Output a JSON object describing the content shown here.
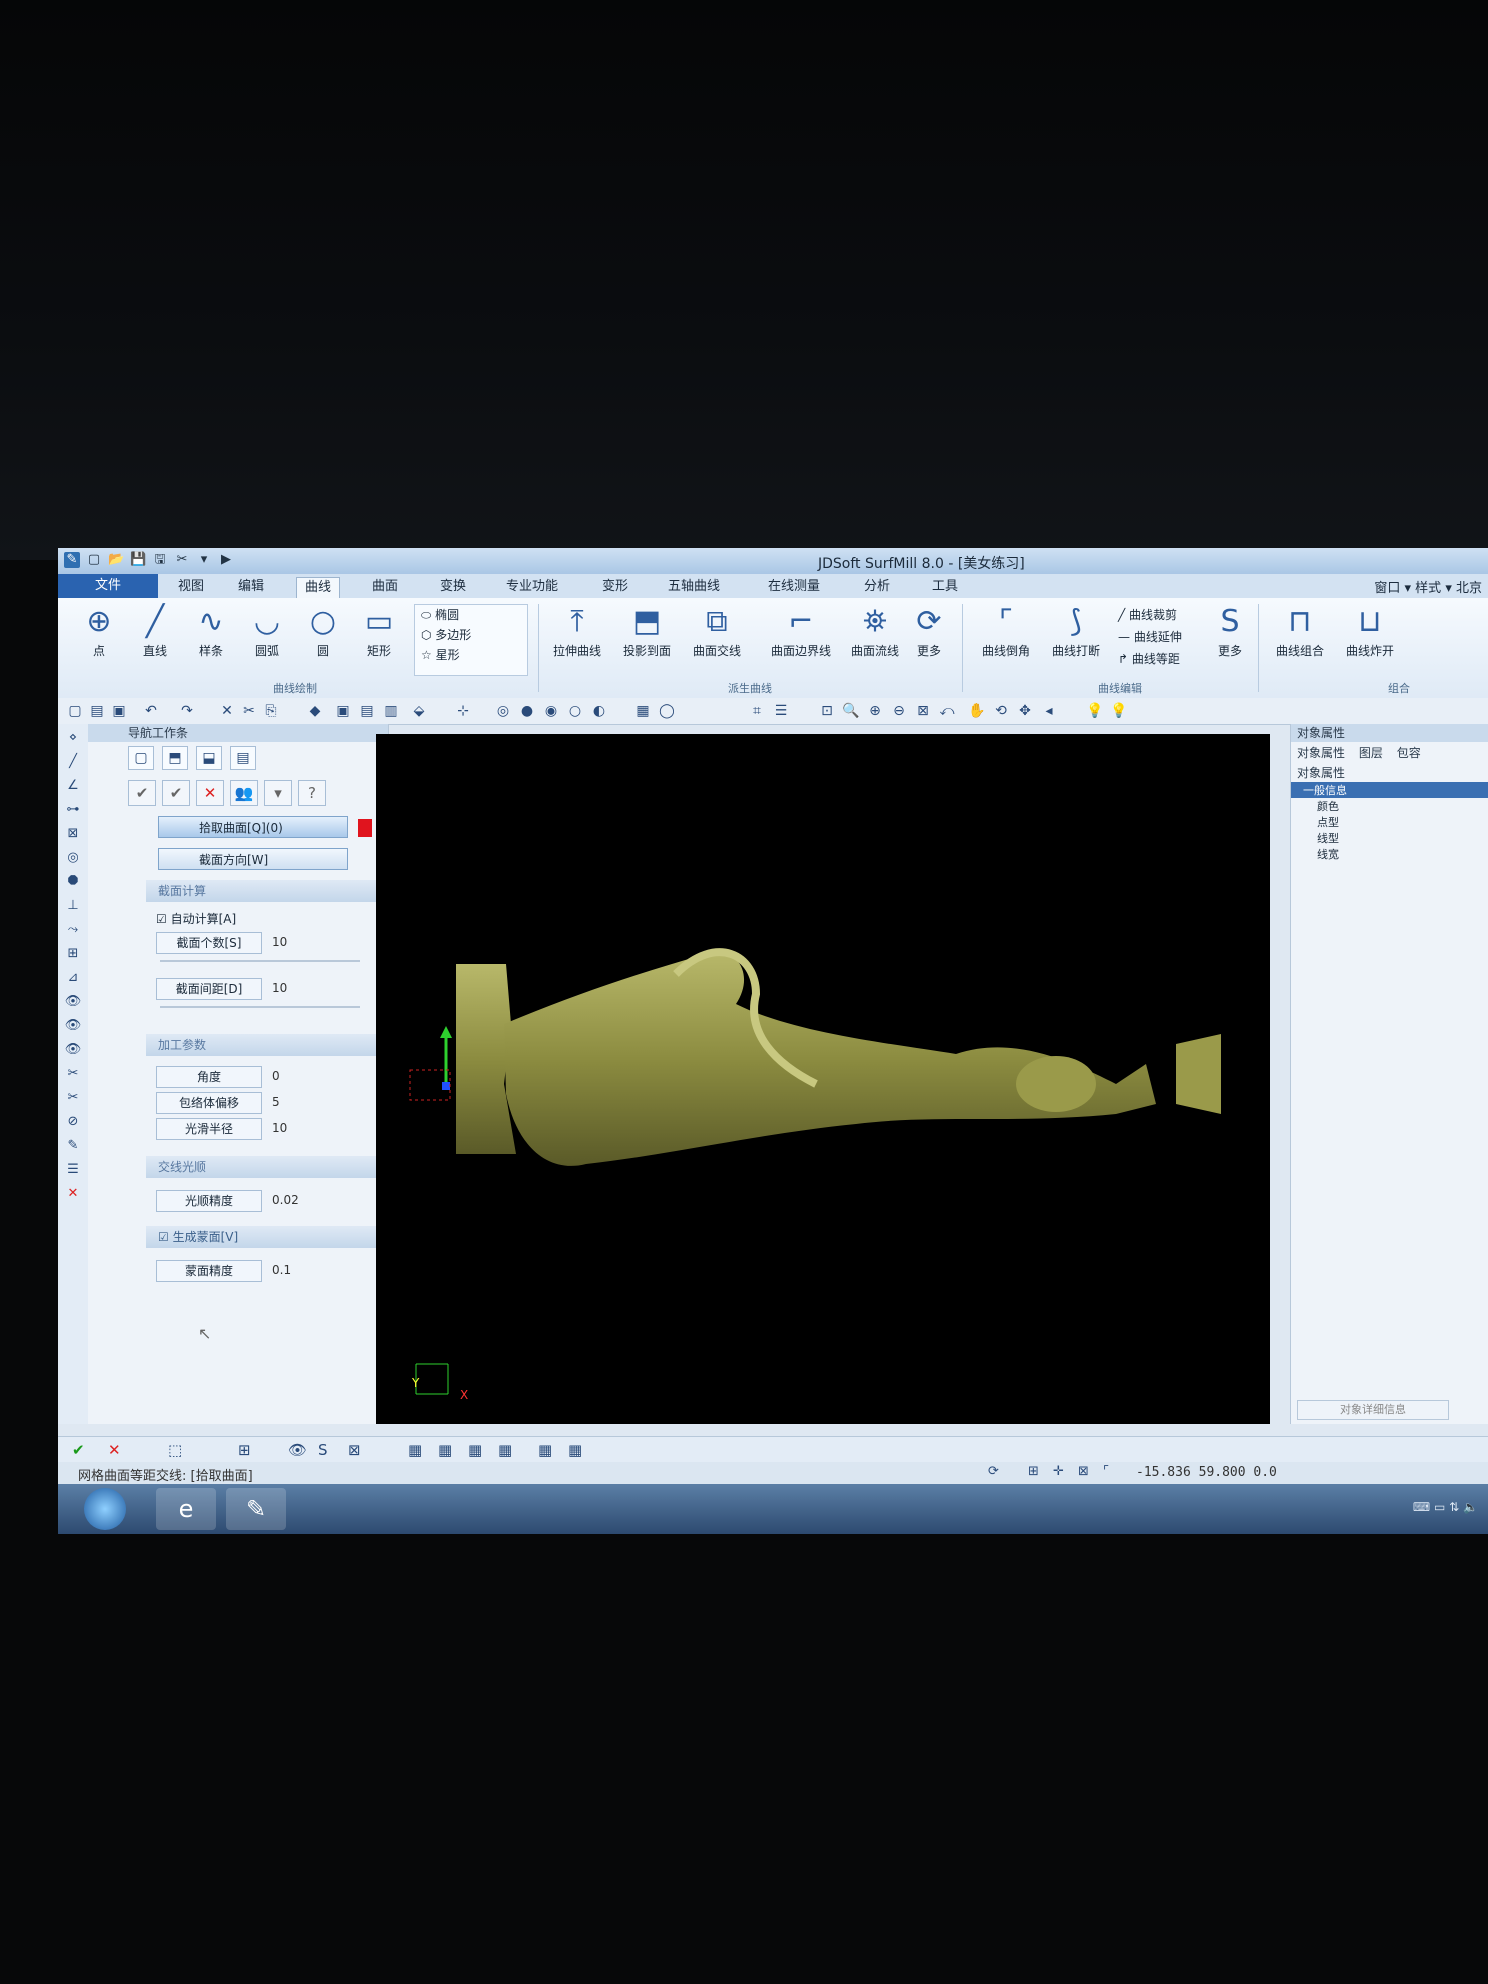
{
  "window": {
    "title": "JDSoft SurfMill 8.0 - [美女练习]"
  },
  "menu_tabs": [
    "文件",
    "视图",
    "编辑",
    "曲线",
    "曲面",
    "变换",
    "专业功能",
    "变形",
    "五轴曲线",
    "在线测量",
    "分析",
    "工具"
  ],
  "menu_right": [
    "窗口",
    "样式",
    "北京"
  ],
  "ribbon": {
    "draw": [
      "点",
      "直线",
      "样条",
      "圆弧",
      "圆",
      "矩形"
    ],
    "shapes": [
      "椭圆",
      "多边形",
      "星形"
    ],
    "draw_group": "曲线绘制",
    "derived": [
      "拉伸曲线",
      "投影到面",
      "曲面交线",
      "曲面边界线",
      "曲面流线",
      "更多"
    ],
    "derived_group": "派生曲线",
    "edit": [
      "曲线倒角",
      "曲线打断"
    ],
    "edit_small": [
      "曲线裁剪",
      "曲线延伸",
      "曲线等距"
    ],
    "edit_more": "更多",
    "edit_group": "曲线编辑",
    "combine": [
      "曲线组合",
      "曲线炸开"
    ],
    "combine_group": "组合"
  },
  "nav": {
    "title": "导航工作条",
    "pick_surface": "拾取曲面[Q](0)",
    "section_dir": "截面方向[W]",
    "section_calc": "截面计算",
    "auto_calc": "自动计算[A]",
    "section_count_label": "截面个数[S]",
    "section_count": "10",
    "section_spacing_label": "截面间距[D]",
    "section_spacing": "10",
    "machining_params": "加工参数",
    "angle_label": "角度",
    "angle": "0",
    "envelope_label": "包络体偏移",
    "envelope": "5",
    "smooth_radius_label": "光滑半径",
    "smooth_radius": "10",
    "intersect_smooth": "交线光顺",
    "smooth_precision_label": "光顺精度",
    "smooth_precision": "0.02",
    "gen_skin": "生成蒙面[V]",
    "skin_precision_label": "蒙面精度",
    "skin_precision": "0.1"
  },
  "props": {
    "title": "对象属性",
    "tabs": [
      "对象属性",
      "图层",
      "包容"
    ],
    "label": "对象属性",
    "general": "一般信息",
    "items": [
      "颜色",
      "点型",
      "线型",
      "线宽"
    ],
    "footer": "对象详细信息"
  },
  "viewport": {
    "axis_y": "Y",
    "axis_x": "X"
  },
  "status": {
    "message": "网格曲面等距交线: [拾取曲面]",
    "coords": "-15.836 59.800 0.0"
  },
  "colors": {
    "model": "#9a9a4a",
    "background": "#000000",
    "accent": "#2a63b0"
  }
}
